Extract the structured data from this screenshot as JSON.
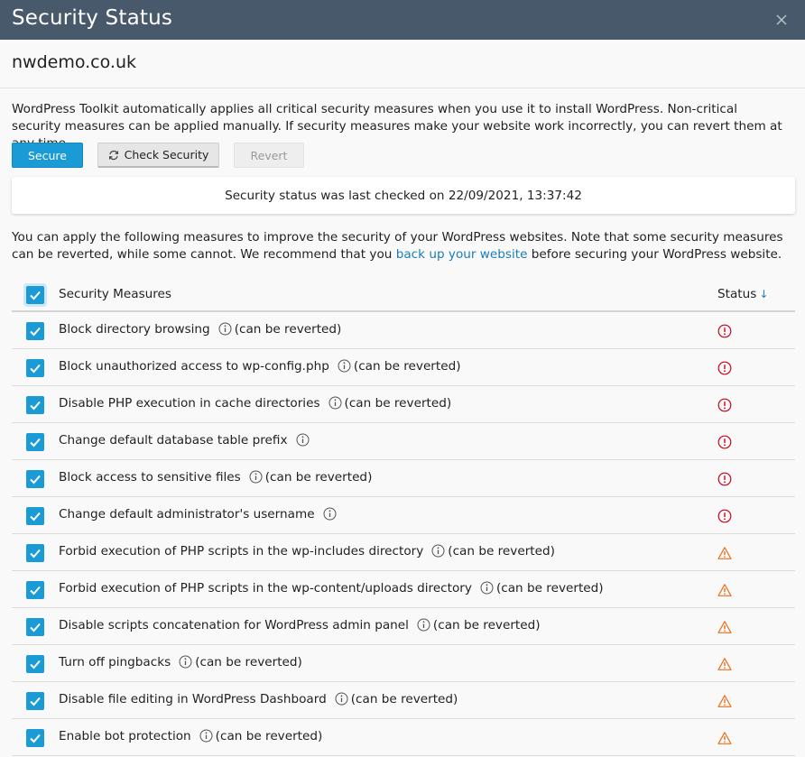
{
  "dialog": {
    "title": "Security Status",
    "site": "nwdemo.co.uk",
    "intro": "WordPress Toolkit automatically applies all critical security measures when you use it to install WordPress. Non-critical security measures can be applied manually. If security measures make your website work incorrectly, you can revert them at any time."
  },
  "toolbar": {
    "secure_label": "Secure",
    "check_label": "Check Security",
    "revert_label": "Revert"
  },
  "status_box": "Security status was last checked on 22/09/2021, 13:37:42",
  "note": {
    "before": "You can apply the following measures to improve the security of your WordPress websites. Note that some security measures can be reverted, while some cannot. We recommend that you ",
    "link": "back up your website",
    "after": " before securing your WordPress website."
  },
  "table": {
    "header_label": "Security Measures",
    "header_status": "Status",
    "sort_arrow": "↓",
    "rows": [
      {
        "label": "Block directory browsing",
        "suffix": "(can be reverted)",
        "status": "critical"
      },
      {
        "label": "Block unauthorized access to wp-config.php",
        "suffix": "(can be reverted)",
        "status": "critical"
      },
      {
        "label": "Disable PHP execution in cache directories",
        "suffix": "(can be reverted)",
        "status": "critical"
      },
      {
        "label": "Change default database table prefix",
        "suffix": "",
        "status": "critical"
      },
      {
        "label": "Block access to sensitive files",
        "suffix": "(can be reverted)",
        "status": "critical"
      },
      {
        "label": "Change default administrator's username",
        "suffix": "",
        "status": "critical"
      },
      {
        "label": "Forbid execution of PHP scripts in the wp-includes directory",
        "suffix": "(can be reverted)",
        "status": "warning"
      },
      {
        "label": "Forbid execution of PHP scripts in the wp-content/uploads directory",
        "suffix": "(can be reverted)",
        "status": "warning"
      },
      {
        "label": "Disable scripts concatenation for WordPress admin panel",
        "suffix": "(can be reverted)",
        "status": "warning"
      },
      {
        "label": "Turn off pingbacks",
        "suffix": "(can be reverted)",
        "status": "warning"
      },
      {
        "label": "Disable file editing in WordPress Dashboard",
        "suffix": "(can be reverted)",
        "status": "warning"
      },
      {
        "label": "Enable bot protection",
        "suffix": "(can be reverted)",
        "status": "warning"
      }
    ]
  },
  "colors": {
    "titlebar": "#48596c",
    "accent": "#1a9bd6",
    "critical": "#d0021b",
    "warning": "#e8701a",
    "link": "#1a7db8"
  }
}
